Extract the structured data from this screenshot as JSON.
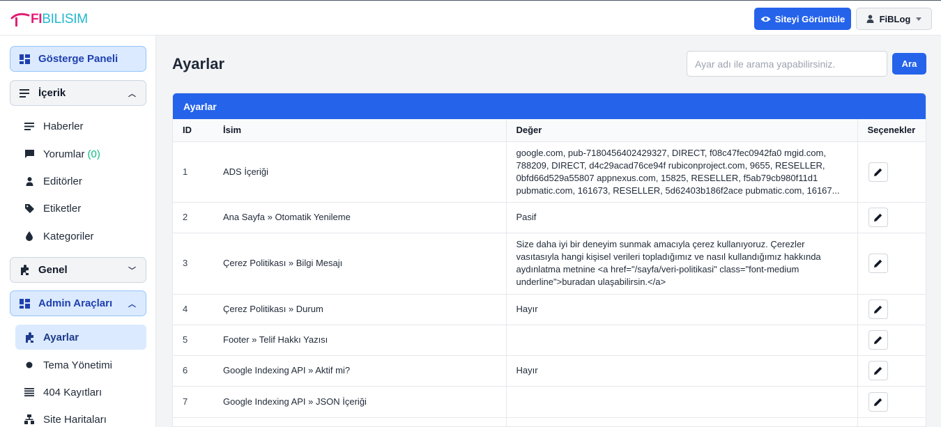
{
  "header": {
    "logo_fi": "FI",
    "logo_rest": "BILISIM",
    "view_site_label": "Siteyi Görüntüle",
    "user_label": "FiBLog"
  },
  "sidebar": {
    "dashboard": "Gösterge Paneli",
    "content": "İçerik",
    "content_items": [
      {
        "label": "Haberler",
        "icon": "list-icon"
      },
      {
        "label": "Yorumlar",
        "count": "(0)",
        "icon": "comment-icon"
      },
      {
        "label": "Editörler",
        "icon": "user-icon"
      },
      {
        "label": "Etiketler",
        "icon": "tag-icon"
      },
      {
        "label": "Kategoriler",
        "icon": "drop-icon"
      }
    ],
    "general": "Genel",
    "admin_tools": "Admin Araçları",
    "admin_items": [
      {
        "label": "Ayarlar",
        "icon": "puzzle-icon"
      },
      {
        "label": "Tema Yönetimi",
        "icon": "dot-icon"
      },
      {
        "label": "404 Kayıtları",
        "icon": "lines-icon"
      },
      {
        "label": "Site Haritaları",
        "icon": "sitemap-icon"
      }
    ]
  },
  "main": {
    "title": "Ayarlar",
    "search_placeholder": "Ayar adı ile arama yapabilirsiniz.",
    "search_button": "Ara",
    "card_title": "Ayarlar",
    "columns": {
      "id": "ID",
      "name": "İsim",
      "value": "Değer",
      "options": "Seçenekler"
    },
    "rows": [
      {
        "id": "1",
        "name": "ADS İçeriği",
        "value": "google.com, pub-7180456402429327, DIRECT, f08c47fec0942fa0 mgid.com, 788209, DIRECT, d4c29acad76ce94f rubiconproject.com, 9655, RESELLER, 0bfd66d529a55807 appnexus.com, 15825, RESELLER, f5ab79cb980f11d1 pubmatic.com, 161673, RESELLER, 5d62403b186f2ace pubmatic.com, 16167..."
      },
      {
        "id": "2",
        "name": "Ana Sayfa » Otomatik Yenileme",
        "value": "Pasif"
      },
      {
        "id": "3",
        "name": "Çerez Politikası » Bilgi Mesajı",
        "value": "Size daha iyi bir deneyim sunmak amacıyla çerez kullanıyoruz. Çerezler vasıtasıyla hangi kişisel verileri topladığımız ve nasıl kullandığımız hakkında aydınlatma metnine <a href=\"/sayfa/veri-politikasi\" class=\"font-medium underline\">buradan ulaşabilirsin.</a>"
      },
      {
        "id": "4",
        "name": "Çerez Politikası » Durum",
        "value": "Hayır"
      },
      {
        "id": "5",
        "name": "Footer » Telif Hakkı Yazısı",
        "value": ""
      },
      {
        "id": "6",
        "name": "Google Indexing API » Aktif mi?",
        "value": "Hayır"
      },
      {
        "id": "7",
        "name": "Google Indexing API » JSON İçeriği",
        "value": ""
      }
    ]
  },
  "colors": {
    "primary": "#2563eb",
    "active_bg": "#dbeafe",
    "count": "#10b981",
    "logo_pink": "#e11d74",
    "logo_cyan": "#22b8cf"
  }
}
